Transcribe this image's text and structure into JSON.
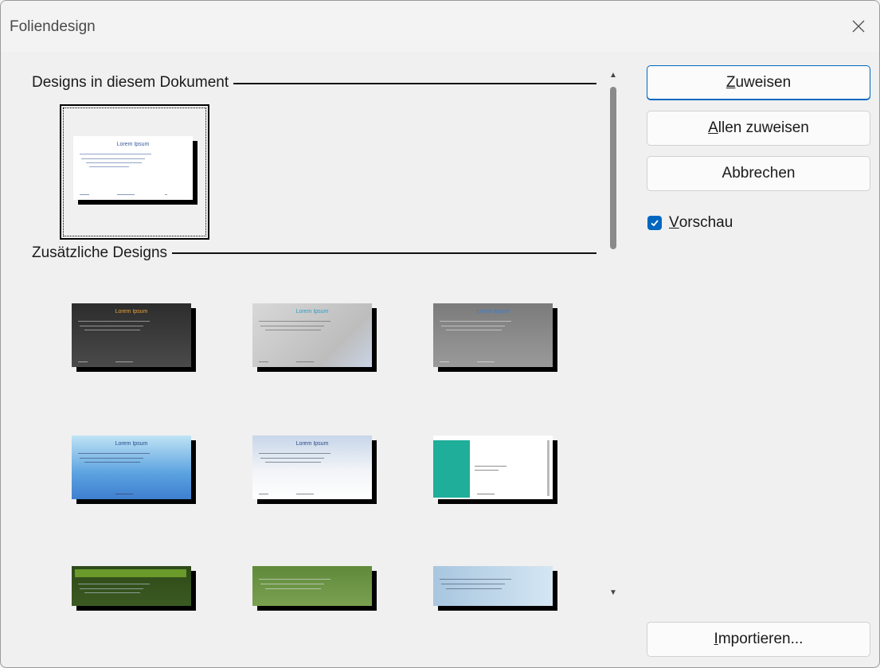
{
  "window": {
    "title": "Foliendesign"
  },
  "sections": {
    "current_label": "Designs in diesem Dokument",
    "additional_label": "Zusätzliche Designs"
  },
  "thumbnail_text": {
    "title": "Lorem Ipsum"
  },
  "buttons": {
    "assign_mnemonic": "Z",
    "assign_rest": "uweisen",
    "assign_all_mnemonic": "A",
    "assign_all_rest": "llen zuweisen",
    "cancel": "Abbrechen",
    "import_mnemonic": "I",
    "import_rest": "mportieren..."
  },
  "preview": {
    "mnemonic": "V",
    "rest": "orschau",
    "checked": true
  },
  "colors": {
    "accent": "#0067c0",
    "design_backgrounds": [
      "#ffffff",
      "#3b3b3b",
      "#cfcfcf",
      "#8a8a8a",
      "#7fbfe6",
      "#e8eef5",
      "#ffffff",
      "#2f4a1b",
      "#6f8f4a",
      "#b9d3e6"
    ]
  }
}
